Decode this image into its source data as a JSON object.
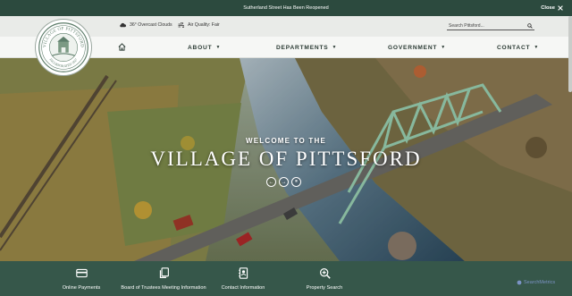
{
  "alert": {
    "message": "Sutherland Street Has Been Reopened",
    "close_label": "Close"
  },
  "info": {
    "weather": "36° Overcast Clouds",
    "air_quality": "Air Quality: Fair",
    "search_placeholder": "Search Pittsford..."
  },
  "logo": {
    "top_text": "VILLAGE OF PITTSFORD",
    "bottom_text": "INCORPORATED 1827"
  },
  "nav": {
    "items": [
      {
        "label": "ABOUT"
      },
      {
        "label": "DEPARTMENTS"
      },
      {
        "label": "GOVERNMENT"
      },
      {
        "label": "CONTACT"
      }
    ]
  },
  "hero": {
    "welcome": "WELCOME TO THE",
    "title": "VILLAGE OF PITTSFORD",
    "controls": [
      "prev-icon",
      "next-icon",
      "pause-icon"
    ]
  },
  "quick_links": [
    {
      "label": "Online Payments",
      "icon": "credit-card-icon"
    },
    {
      "label": "Board of Trustees Meeting Information",
      "icon": "copy-document-icon"
    },
    {
      "label": "Contact Information",
      "icon": "contact-book-icon"
    },
    {
      "label": "Property Search",
      "icon": "search-plus-icon"
    }
  ],
  "watermark": "SearchMetrics",
  "colors": {
    "primary": "#2c4a3e",
    "quickbar": "#36574a",
    "nav_bg": "#f6f7f5"
  }
}
